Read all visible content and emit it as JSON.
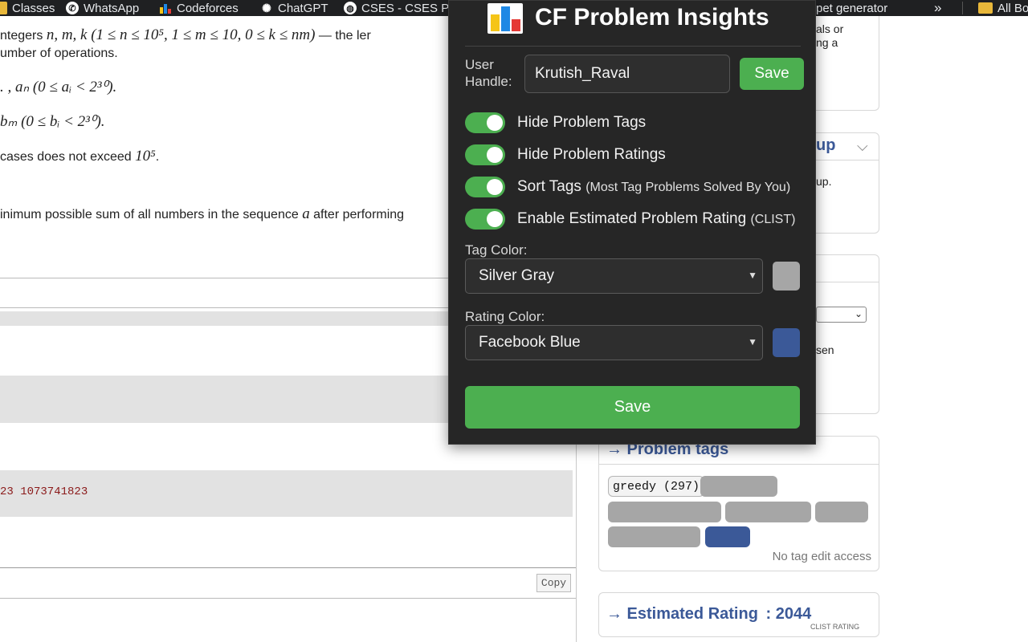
{
  "bookmarks": [
    {
      "label": "Classes",
      "icon": "folder-icon"
    },
    {
      "label": "WhatsApp",
      "icon": "whatsapp-icon"
    },
    {
      "label": "Codeforces",
      "icon": "codeforces-icon"
    },
    {
      "label": "ChatGPT",
      "icon": "chatgpt-icon"
    },
    {
      "label": "CSES - CSES Pro",
      "icon": "globe-icon"
    },
    {
      "label": "pet generator",
      "icon": ""
    },
    {
      "label": "»",
      "icon": ""
    },
    {
      "label": "All Bo",
      "icon": "folder-icon"
    }
  ],
  "problem": {
    "line1_prefix": "ntegers ",
    "line1_math": "n, m, k (1 ≤ n ≤ 10⁵, 1 ≤ m ≤ 10, 0 ≤ k ≤ nm)",
    "line1_suffix": " — the ler",
    "line2": "umber of operations.",
    "line3_math": ". , aₙ (0 ≤ aᵢ < 2³⁰).",
    "line4_math": "bₘ (0 ≤ bᵢ < 2³⁰).",
    "line5_prefix": "cases does not exceed ",
    "line5_math": "10⁵",
    "line5_suffix": ".",
    "line6_prefix": "inimum possible sum of all numbers in the sequence ",
    "line6_math": "a",
    "line6_suffix": " after performing",
    "sample_value": "23 1073741823",
    "copy_label": "Copy"
  },
  "sidebar": {
    "partial_text_1": "als or",
    "partial_text_2": "ng a",
    "group_title": "up",
    "group_text": "up.",
    "chosen_text": "sen",
    "tags_title": "→ Problem tags",
    "tag_visible": "greedy (297)",
    "tag_note": "No tag edit access",
    "estimated_title": "→ Estimated Rating",
    "estimated_sep": ":",
    "estimated_value": "2044",
    "estimated_sub": "CLIST RATING"
  },
  "popup": {
    "title": "CF Problem Insights",
    "handle_label_1": "User",
    "handle_label_2": "Handle:",
    "handle_value": "Krutish_Raval",
    "save_small": "Save",
    "toggles": [
      {
        "label": "Hide Problem Tags",
        "sub": "",
        "on": true
      },
      {
        "label": "Hide Problem Ratings",
        "sub": "",
        "on": true
      },
      {
        "label": "Sort Tags",
        "sub": "(Most Tag Problems Solved By You)",
        "on": true
      },
      {
        "label": "Enable Estimated Problem Rating",
        "sub": "(CLIST)",
        "on": true
      }
    ],
    "tag_color_label": "Tag Color:",
    "tag_color_value": "Silver Gray",
    "tag_color_hex": "#a6a6a6",
    "rating_color_label": "Rating Color:",
    "rating_color_value": "Facebook Blue",
    "rating_color_hex": "#3b5998",
    "save_big": "Save"
  },
  "colors": {
    "accent_green": "#4caf50",
    "link_blue": "#3b5998",
    "popup_bg": "#262626"
  }
}
